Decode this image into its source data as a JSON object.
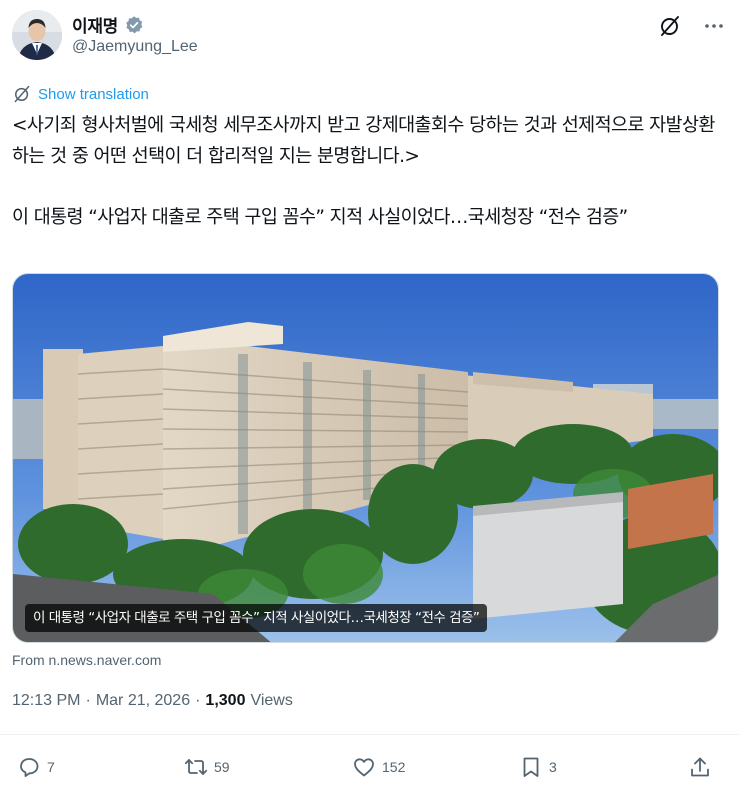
{
  "author": {
    "display_name": "이재명",
    "handle": "@Jaemyung_Lee",
    "verified": true
  },
  "icons": {
    "avatar": "profile-avatar",
    "verified": "verified-badge-icon",
    "grok": "grok-icon",
    "more": "more-icon",
    "translate": "translate-icon",
    "reply": "reply-icon",
    "retweet": "retweet-icon",
    "like": "like-icon",
    "bookmark": "bookmark-icon",
    "share": "share-icon"
  },
  "translate_label": "Show translation",
  "tweet_text": "<사기죄 형사처벌에 국세청 세무조사까지 받고 강제대출회수 당하는 것과 선제적으로 자발상환 하는 것 중 어떤 선택이 더 합리적일 지는 분명합니다.>\n\n이 대통령 “사업자 대출로 주택 구입 꼼수” 지적 사실이었다…국세청장 “전수 검증”",
  "media_caption": "이 대통령 “사업자 대출로 주택 구입 꼼수” 지적 사실이었다…국세청장 “전수 검증”",
  "source": "From n.news.naver.com",
  "meta": {
    "time": "12:13 PM",
    "date": "Mar 21, 2026",
    "views_count": "1,300",
    "views_label": "Views",
    "separator": "·"
  },
  "actions": {
    "replies": "7",
    "retweets": "59",
    "likes": "152",
    "bookmarks": "3"
  },
  "colors": {
    "accent": "#1d9bf0",
    "secondary_text": "#536471",
    "primary_text": "#0f1419"
  }
}
